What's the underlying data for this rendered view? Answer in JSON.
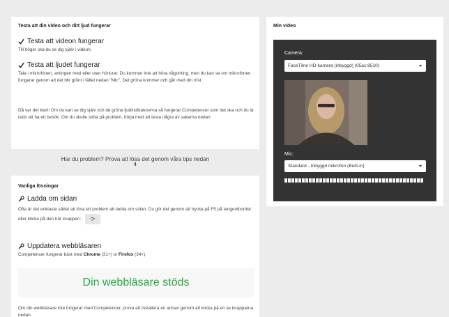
{
  "test_card": {
    "title": "Testa att din video och ditt ljud fungerar",
    "video_heading": "Testa att videon fungerar",
    "video_text": "Till höger ska du se dig själv i videon.",
    "audio_heading": "Testa att ljudet fungerar",
    "audio_text": "Tala i mikrofonen, antingen med eller utan hörlurar. Du kommer inte att höra någonting, men du kan se om mikrofonen fungerar genom att det blir grönt i fältet nedan \"Mic\". Det gröna kommer och går med din röst",
    "done_text": "Då var det klart! Om du kan se dig själv och de gröna ljudindikatorerna så fungerar Competencer som det ska och du är redo att ha ett besök. Om du skulle stöta på problem, börja med att testa några av sakerna nedan"
  },
  "problem_banner": {
    "text": "Har du problem? Prova att lösa det genom våra tips nedan",
    "arrow": "⬇"
  },
  "solutions_card": {
    "title": "Vanliga lösningar",
    "reload_heading": "Ladda om sidan",
    "reload_text": "Ofta är det enklaste sättet att lösa ett problem att ladda om sidan. Du gör det genom att trycka på F5 på tangentbordet eller klicka på den här knappen:",
    "reload_button": "⟳",
    "update_heading": "Uppdatera webbläsaren",
    "update_prefix": "Competencer fungerar bäst med ",
    "browser_chrome": "Chrome",
    "chrome_version": " (31+) or ",
    "browser_firefox": "Firefox",
    "firefox_version": " (34+).",
    "supported_text": "Din webbläsare stöds",
    "fallback_text": "Om din webbläsare inte fungerar med Competencer, prova att installera en annan genom att klicka på en av knapparna nedan"
  },
  "video_card": {
    "title": "Min video",
    "camera_label": "Camera:",
    "camera_value": "FaceTime HD-kamera (inbyggd) (05ac:8510)",
    "mic_label": "Mic:",
    "mic_value": "Standard - Inbyggd mikrofon (Built-in)"
  },
  "colors": {
    "supported_green": "#28a745",
    "panel_dark": "#333333",
    "page_bg": "#ececec"
  }
}
